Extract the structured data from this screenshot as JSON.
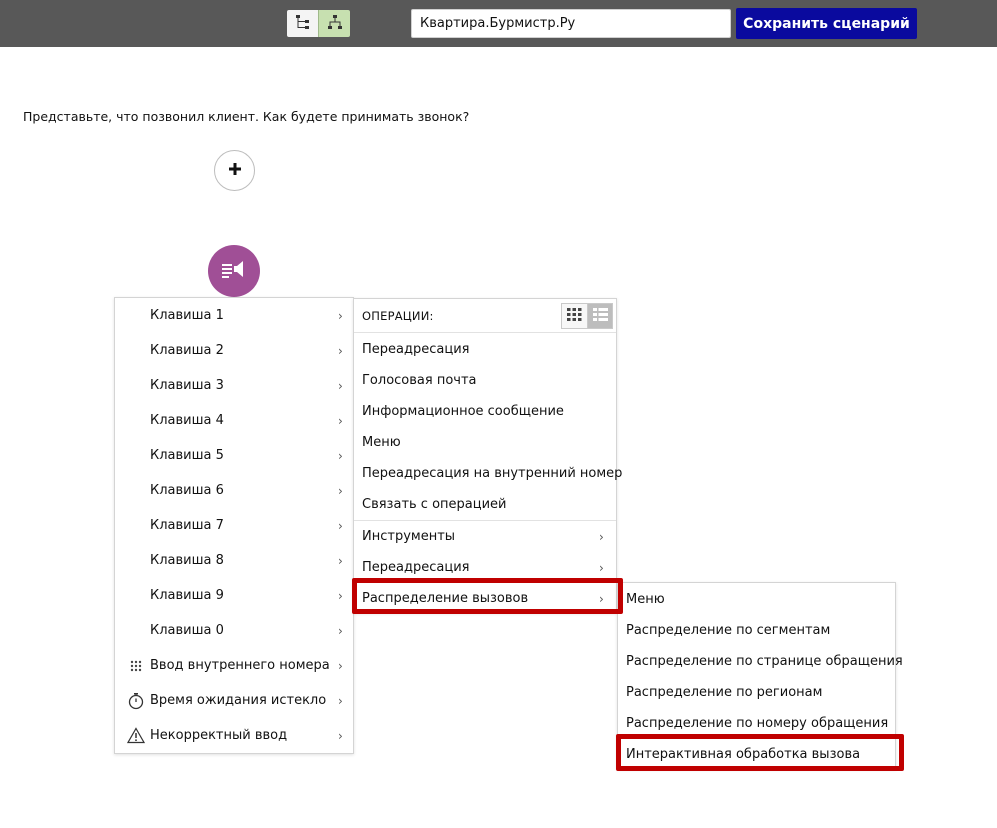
{
  "header": {
    "view_toggle": [
      {
        "icon": "tree-list-icon",
        "active": false
      },
      {
        "icon": "tree-hierarchy-icon",
        "active": true
      }
    ],
    "scenario_name": "Квартира.Бурмистр.Ру",
    "save_label": "Сохранить сценарий"
  },
  "prompt": "Представьте, что позвонил клиент. Как будете принимать звонок?",
  "canvas": {
    "add_icon": "plus-icon",
    "node_icon": "announcement-icon",
    "node_color": "#a04f96"
  },
  "keys_menu": {
    "items": [
      {
        "label": "Клавиша 1"
      },
      {
        "label": "Клавиша 2"
      },
      {
        "label": "Клавиша 3"
      },
      {
        "label": "Клавиша 4"
      },
      {
        "label": "Клавиша 5"
      },
      {
        "label": "Клавиша 6"
      },
      {
        "label": "Клавиша 7"
      },
      {
        "label": "Клавиша 8"
      },
      {
        "label": "Клавиша 9"
      },
      {
        "label": "Клавиша 0"
      },
      {
        "label": "Ввод внутреннего номера",
        "icon": "keypad-icon"
      },
      {
        "label": "Время ожидания истекло",
        "icon": "stopwatch-icon"
      },
      {
        "label": "Некорректный ввод",
        "icon": "warning-icon"
      }
    ]
  },
  "ops_menu": {
    "header": "ОПЕРАЦИИ:",
    "view_buttons": [
      {
        "icon": "grid-view-icon",
        "active": false
      },
      {
        "icon": "list-view-icon",
        "active": true
      }
    ],
    "operations": [
      {
        "label": "Переадресация"
      },
      {
        "label": "Голосовая почта"
      },
      {
        "label": "Информационное сообщение"
      },
      {
        "label": "Меню"
      },
      {
        "label": "Переадресация на внутренний номер"
      },
      {
        "label": "Связать с операцией"
      }
    ],
    "groups": [
      {
        "label": "Инструменты"
      },
      {
        "label": "Переадресация"
      },
      {
        "label": "Распределение вызовов",
        "highlighted": true
      }
    ]
  },
  "dist_menu": {
    "items": [
      {
        "label": "Меню"
      },
      {
        "label": "Распределение по сегментам"
      },
      {
        "label": "Распределение по странице обращения"
      },
      {
        "label": "Распределение по регионам"
      },
      {
        "label": "Распределение по номеру обращения"
      },
      {
        "label": "Интерактивная обработка вызова",
        "highlighted": true
      }
    ]
  },
  "colors": {
    "topbar": "#585858",
    "save_button": "#0a0a9e",
    "highlight": "#c00000"
  }
}
